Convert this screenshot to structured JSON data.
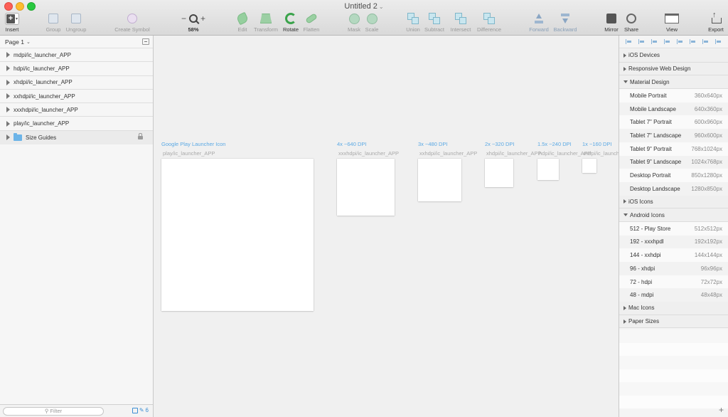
{
  "window": {
    "title": "Untitled 2"
  },
  "toolbar": {
    "insert": "Insert",
    "group": "Group",
    "ungroup": "Ungroup",
    "create_symbol": "Create Symbol",
    "zoom_minus": "−",
    "zoom_plus": "+",
    "zoom_level": "58%",
    "edit": "Edit",
    "transform": "Transform",
    "rotate": "Rotate",
    "flatten": "Flatten",
    "mask": "Mask",
    "scale": "Scale",
    "union": "Union",
    "subtract": "Subtract",
    "intersect": "Intersect",
    "difference": "Difference",
    "forward": "Forward",
    "backward": "Backward",
    "mirror": "Mirror",
    "share": "Share",
    "view": "View",
    "export": "Export"
  },
  "sidebar": {
    "page": "Page 1",
    "layers": [
      "mdpi/ic_launcher_APP",
      "hdpi/ic_launcher_APP",
      "xhdpi/ic_launcher_APP",
      "xxhdpi/ic_launcher_APP",
      "xxxhdpi/ic_launcher_APP",
      "play/ic_launcher_APP"
    ],
    "group": "Size Guides",
    "filter_placeholder": "Filter",
    "filter_count": "6"
  },
  "canvas": {
    "artboards": [
      {
        "title": "Google Play Launcher Icon",
        "name": "play/ic_launcher_APP"
      },
      {
        "title": "4x ~640 DPI",
        "name": "xxxhdpi/ic_launcher_APP"
      },
      {
        "title": "3x ~480 DPI",
        "name": "xxhdpi/ic_launcher_APP"
      },
      {
        "title": "2x ~320 DPI",
        "name": "xhdpi/ic_launcher_APP"
      },
      {
        "title": "1.5x ~240 DPI",
        "name": "hdpi/ic_launcher_APP"
      },
      {
        "title": "1x ~160 DPI",
        "name": "mdpi/ic_launcher_APP"
      }
    ]
  },
  "inspector": {
    "sections": {
      "ios_devices": "iOS Devices",
      "responsive": "Responsive Web Design",
      "material": "Material Design",
      "ios_icons": "iOS Icons",
      "android_icons": "Android Icons",
      "mac_icons": "Mac Icons",
      "paper_sizes": "Paper Sizes"
    },
    "material_items": [
      {
        "name": "Mobile Portrait",
        "dim": "360x640px"
      },
      {
        "name": "Mobile Landscape",
        "dim": "640x360px"
      },
      {
        "name": "Tablet 7\" Portrait",
        "dim": "600x960px"
      },
      {
        "name": "Tablet 7\" Landscape",
        "dim": "960x600px"
      },
      {
        "name": "Tablet 9\" Portrait",
        "dim": "768x1024px"
      },
      {
        "name": "Tablet 9\" Landscape",
        "dim": "1024x768px"
      },
      {
        "name": "Desktop Portrait",
        "dim": "850x1280px"
      },
      {
        "name": "Desktop Landscape",
        "dim": "1280x850px"
      }
    ],
    "android_items": [
      {
        "name": "512 - Play Store",
        "dim": "512x512px"
      },
      {
        "name": "192 - xxxhpdl",
        "dim": "192x192px"
      },
      {
        "name": "144 - xxhdpi",
        "dim": "144x144px"
      },
      {
        "name": "96 - xhdpi",
        "dim": "96x96px"
      },
      {
        "name": "72 - hdpi",
        "dim": "72x72px"
      },
      {
        "name": "48 - mdpi",
        "dim": "48x48px"
      }
    ],
    "add_label": "+"
  },
  "colors": {
    "accent": "#3b8ed3",
    "artboard_title": "#5ba9e4",
    "rotate_green": "#3aa34b"
  }
}
